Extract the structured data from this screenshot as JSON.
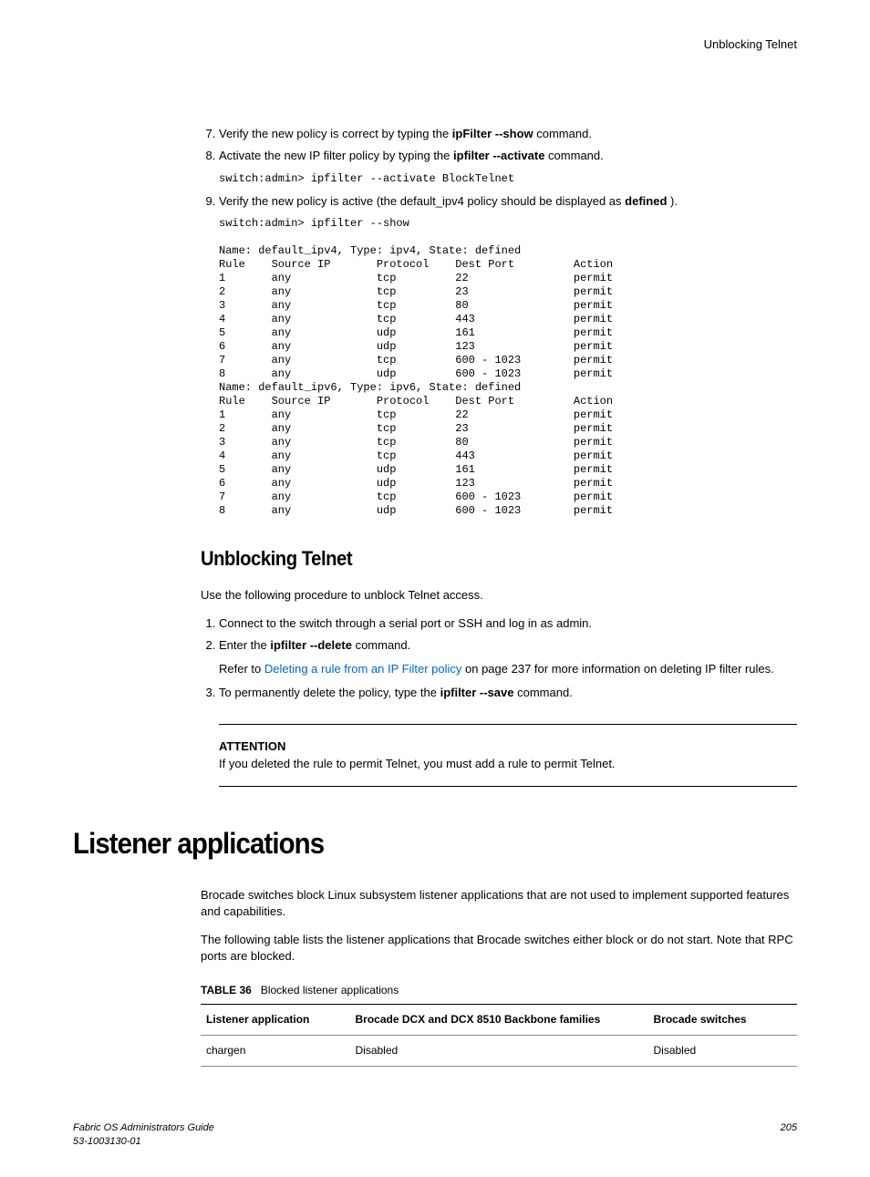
{
  "header": {
    "right": "Unblocking Telnet"
  },
  "list1": {
    "item7_a": "Verify the new policy is correct by typing the ",
    "item7_b": "ipFilter --show",
    "item7_c": " command.",
    "item8_a": "Activate the new IP filter policy by typing the ",
    "item8_b": "ipfilter --activate",
    "item8_c": " command.",
    "code8": "switch:admin> ipfilter --activate BlockTelnet",
    "item9_a": "Verify the new policy is active (the default_ipv4 policy should be displayed as ",
    "item9_b": "defined",
    "item9_c": " ).",
    "code9": "switch:admin> ipfilter --show\n\nName: default_ipv4, Type: ipv4, State: defined\nRule    Source IP       Protocol    Dest Port         Action\n1       any             tcp         22                permit\n2       any             tcp         23                permit\n3       any             tcp         80                permit\n4       any             tcp         443               permit\n5       any             udp         161               permit\n6       any             udp         123               permit\n7       any             tcp         600 - 1023        permit\n8       any             udp         600 - 1023        permit\nName: default_ipv6, Type: ipv6, State: defined\nRule    Source IP       Protocol    Dest Port         Action\n1       any             tcp         22                permit\n2       any             tcp         23                permit\n3       any             tcp         80                permit\n4       any             tcp         443               permit\n5       any             udp         161               permit\n6       any             udp         123               permit\n7       any             tcp         600 - 1023        permit\n8       any             udp         600 - 1023        permit"
  },
  "section2": {
    "title": "Unblocking Telnet",
    "intro": "Use the following procedure to unblock Telnet access.",
    "li1": "Connect to the switch through a serial port or SSH and log in as admin.",
    "li2_a": "Enter the ",
    "li2_b": "ipfilter --delete",
    "li2_c": " command.",
    "li2_ref_a": "Refer to ",
    "li2_ref_link": "Deleting a rule from an IP Filter policy",
    "li2_ref_b": " on page 237 for more information on deleting IP filter rules.",
    "li3_a": "To permanently delete the policy, type the ",
    "li3_b": "ipfilter --save",
    "li3_c": " command.",
    "attn_label": "ATTENTION",
    "attn_text": "If you deleted the rule to permit Telnet, you must add a rule to permit Telnet."
  },
  "section3": {
    "title": "Listener applications",
    "p1": "Brocade switches block Linux subsystem listener applications that are not used to implement supported features and capabilities.",
    "p2": "The following table lists the listener applications that Brocade switches either block or do not start. Note that RPC ports are blocked.",
    "table_label": "TABLE 36",
    "table_caption": "Blocked listener applications",
    "th1": "Listener application",
    "th2": "Brocade DCX and DCX 8510 Backbone families",
    "th3": "Brocade switches",
    "td1": "chargen",
    "td2": "Disabled",
    "td3": "Disabled"
  },
  "footer": {
    "left1": "Fabric OS Administrators Guide",
    "left2": "53-1003130-01",
    "right": "205"
  }
}
